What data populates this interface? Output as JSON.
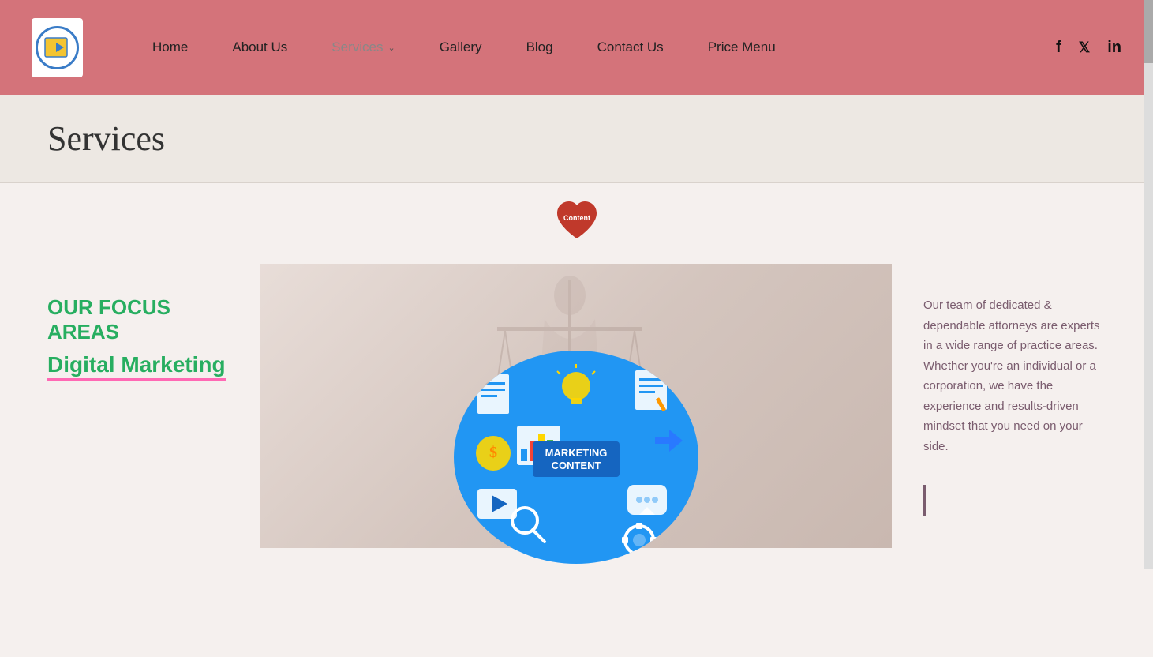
{
  "header": {
    "nav": {
      "home": "Home",
      "about": "About Us",
      "services": "Services",
      "gallery": "Gallery",
      "blog": "Blog",
      "contact": "Contact Us",
      "price": "Price Menu"
    },
    "social": {
      "facebook": "f",
      "twitter": "𝕏",
      "linkedin": "in"
    }
  },
  "page": {
    "title": "Services"
  },
  "heart_badge": {
    "label": "Content"
  },
  "focus": {
    "title": "OUR FOCUS AREAS",
    "subtitle": "Digital Marketing"
  },
  "marketing_circle": {
    "title_line1": "MARKETING",
    "title_line2": "CONTENT"
  },
  "right_text": {
    "paragraph": "Our team of dedicated & dependable attorneys are experts in a wide range of practice areas. Whether you're an individual or a corporation, we have the experience and results-driven mindset that you need on your side."
  }
}
